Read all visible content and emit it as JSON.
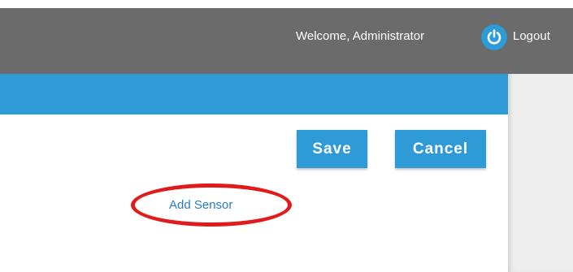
{
  "header": {
    "welcome_text": "Welcome, Administrator",
    "logout_label": "Logout",
    "bar_color": "#6b6b6b",
    "logout_icon": "power-icon"
  },
  "toolbar": {
    "save_label": "Save",
    "cancel_label": "Cancel",
    "accent_color": "#2e9ad6"
  },
  "main": {
    "add_sensor_link": "Add Sensor",
    "highlight_color": "#e01b1b"
  }
}
